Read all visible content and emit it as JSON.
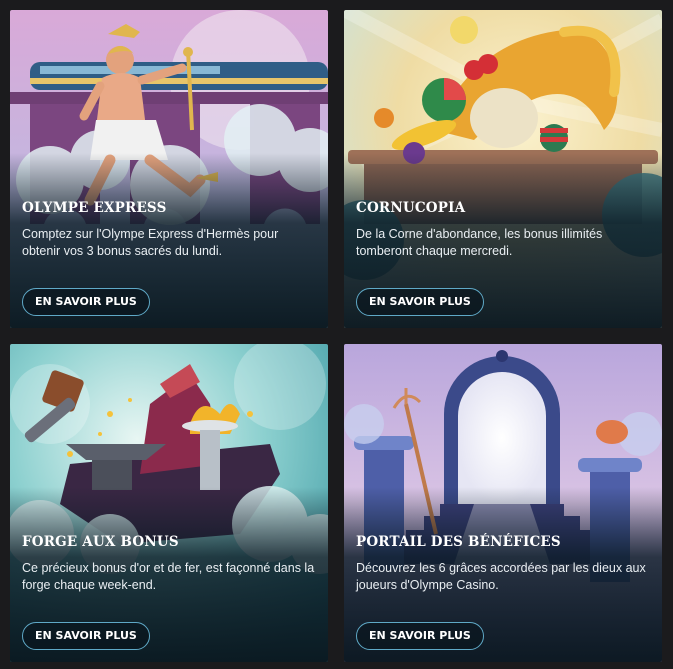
{
  "cards": [
    {
      "title": "OLYMPE EXPRESS",
      "description": "Comptez sur l'Olympe Express d'Hermès pour obtenir vos 3 bonus sacrés du lundi.",
      "button_label": "EN SAVOIR PLUS",
      "image_icon": "hermes-train-illustration"
    },
    {
      "title": "CORNUCOPIA",
      "description": "De la Corne d'abondance, les bonus illimités tomberont chaque mercredi.",
      "button_label": "EN SAVOIR PLUS",
      "image_icon": "cornucopia-illustration"
    },
    {
      "title": "FORGE AUX BONUS",
      "description": "Ce précieux bonus d'or et de fer, est façonné dans la forge chaque week-end.",
      "button_label": "EN SAVOIR PLUS",
      "image_icon": "forge-hammer-illustration"
    },
    {
      "title": "PORTAIL DES BÉNÉFICES",
      "description": "Découvrez les 6 grâces accordées par les dieux aux joueurs d'Olympe Casino.",
      "button_label": "EN SAVOIR PLUS",
      "image_icon": "portal-arch-illustration"
    }
  ],
  "colors": {
    "page_background": "#1b1b1d",
    "button_border": "#5fa9c7",
    "title_text": "#ffffff"
  }
}
